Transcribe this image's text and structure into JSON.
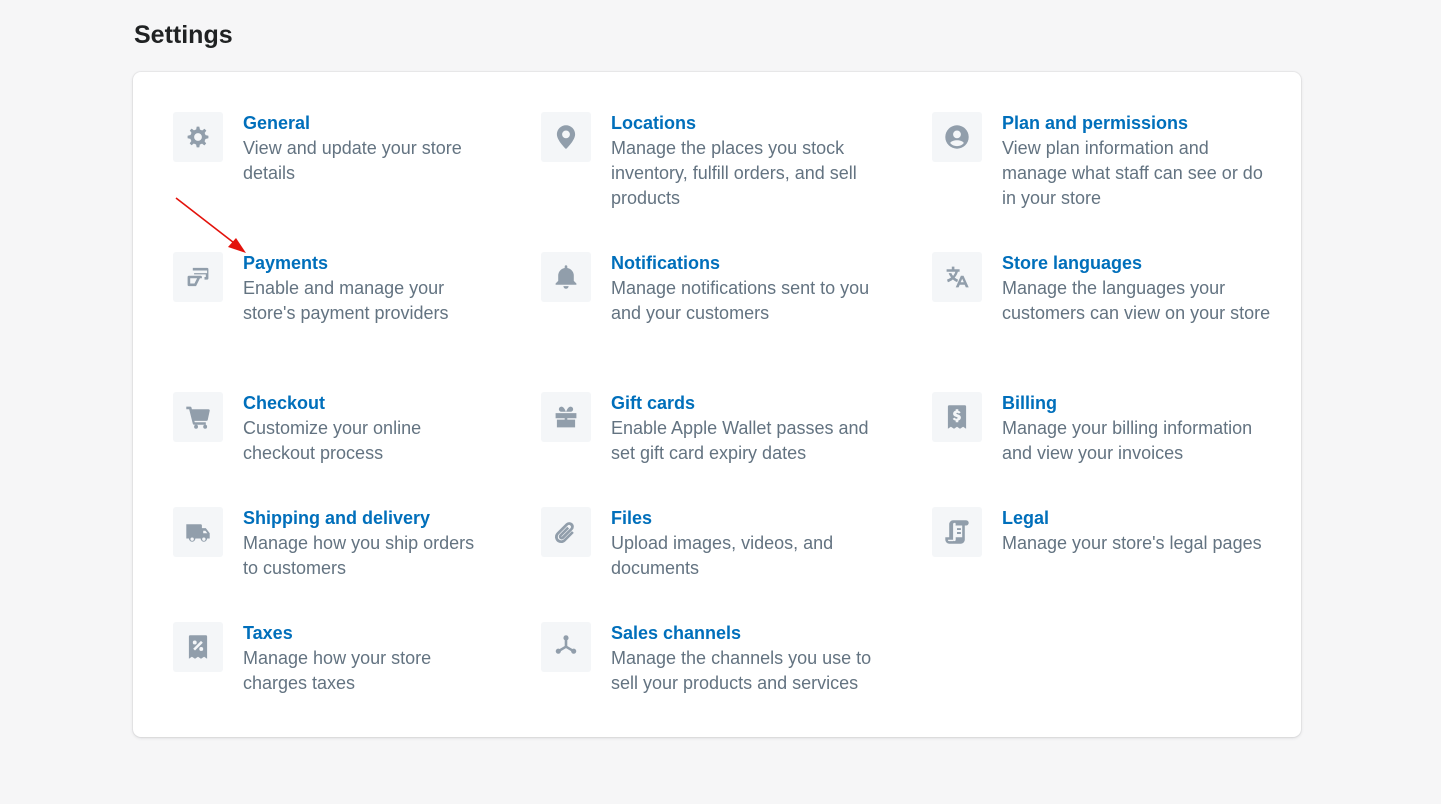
{
  "page": {
    "title": "Settings"
  },
  "colors": {
    "link": "#006fbb",
    "description": "#637381",
    "icon": "#919eab",
    "icon_bg": "#f4f6f8",
    "annotation_arrow": "#e3120b"
  },
  "settings": {
    "general": {
      "icon": "gear-icon",
      "title": "General",
      "description": "View and update your store details"
    },
    "locations": {
      "icon": "location-pin-icon",
      "title": "Locations",
      "description": "Manage the places you stock inventory, fulfill orders, and sell products"
    },
    "plan": {
      "icon": "user-circle-icon",
      "title": "Plan and permissions",
      "description": "View plan information and manage what staff can see or do in your store"
    },
    "payments": {
      "icon": "payment-card-icon",
      "title": "Payments",
      "description": "Enable and manage your store's payment providers"
    },
    "notifications": {
      "icon": "bell-icon",
      "title": "Notifications",
      "description": "Manage notifications sent to you and your customers"
    },
    "languages": {
      "icon": "translate-icon",
      "title": "Store languages",
      "description": "Manage the languages your customers can view on your store"
    },
    "checkout": {
      "icon": "cart-icon",
      "title": "Checkout",
      "description": "Customize your online checkout process"
    },
    "gift_cards": {
      "icon": "gift-icon",
      "title": "Gift cards",
      "description": "Enable Apple Wallet passes and set gift card expiry dates"
    },
    "billing": {
      "icon": "dollar-receipt-icon",
      "title": "Billing",
      "description": "Manage your billing information and view your invoices"
    },
    "shipping": {
      "icon": "truck-icon",
      "title": "Shipping and delivery",
      "description": "Manage how you ship orders to customers"
    },
    "files": {
      "icon": "paperclip-icon",
      "title": "Files",
      "description": "Upload images, videos, and documents"
    },
    "legal": {
      "icon": "legal-document-icon",
      "title": "Legal",
      "description": "Manage your store's legal pages"
    },
    "taxes": {
      "icon": "tax-receipt-icon",
      "title": "Taxes",
      "description": "Manage how your store charges taxes"
    },
    "sales_channels": {
      "icon": "channels-icon",
      "title": "Sales channels",
      "description": "Manage the channels you use to sell your products and services"
    }
  }
}
